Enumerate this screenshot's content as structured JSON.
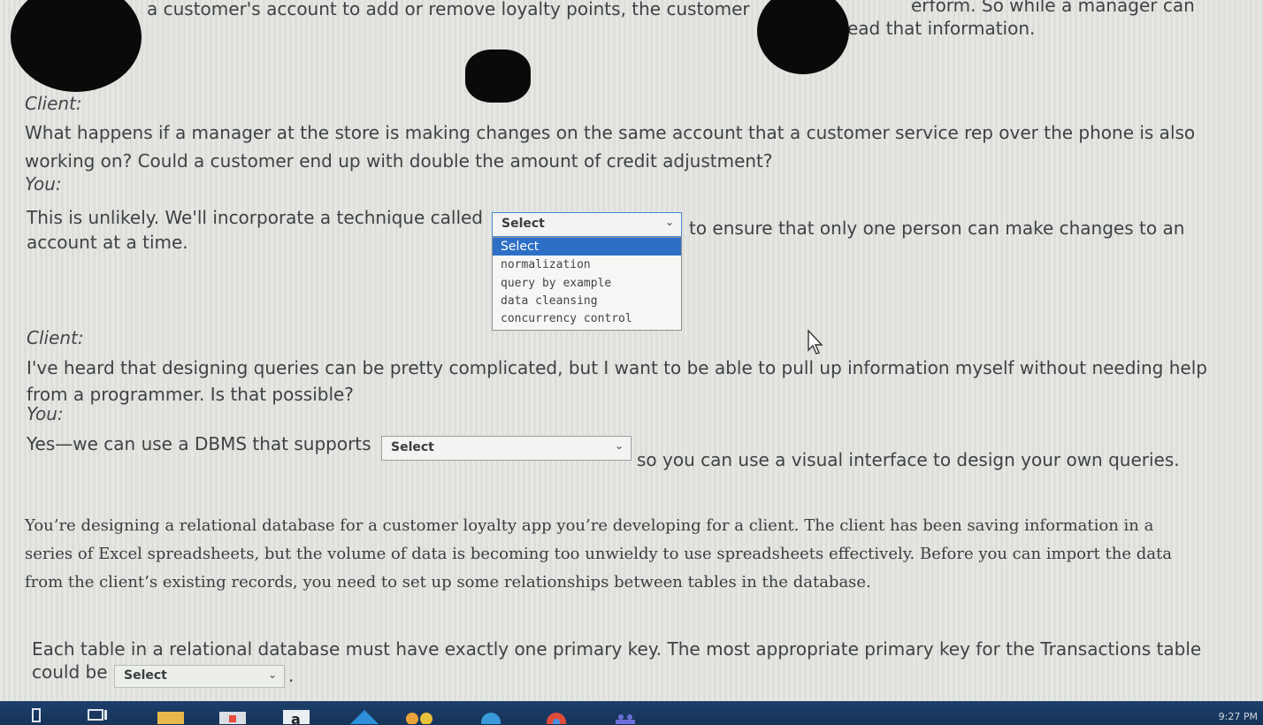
{
  "top": {
    "line1_left": "a customer's account to add or remove loyalty points, the customer",
    "line1_right": "erform. So while a manager can",
    "line2_right": "ead that information."
  },
  "dialog1": {
    "client_label": "Client:",
    "question_line1": "What happens if a manager at the store is making changes on the same account that a customer service rep over the phone is also",
    "question_line2": "working on? Could a customer end up with double the amount of credit adjustment?",
    "you_label": "You:",
    "answer_before": "This is unlikely. We'll incorporate a technique called",
    "answer_after": "to ensure that only one person can make changes to an",
    "answer_line2": "account at a time.",
    "select_value": "Select",
    "options": [
      "Select",
      "normalization",
      "query by example",
      "data cleansing",
      "concurrency control"
    ]
  },
  "dialog2": {
    "client_label": "Client:",
    "question_line1": "I've heard that designing queries can be pretty complicated, but I want to be able to pull up information myself without needing help",
    "question_line2": "from a programmer. Is that possible?",
    "you_label": "You:",
    "answer_before": "Yes—we can use a DBMS that supports",
    "answer_after": "so you can use a visual interface to design your own queries.",
    "select_value": "Select"
  },
  "scenario": {
    "line1": "You’re designing a relational database for a customer loyalty app you’re developing for a client. The client has been saving information in a",
    "line2": "series of Excel spreadsheets, but the volume of data is becoming too unwieldy to use spreadsheets effectively. Before you can import the data",
    "line3": "from the client’s existing records, you need to set up some relationships between tables in the database."
  },
  "question3": {
    "line1": "Each table in a relational database must have exactly one primary key. The most appropriate primary key for the Transactions table",
    "line2_before": "could be",
    "select_value": "Select",
    "line2_after": "."
  },
  "taskbar": {
    "clock": "9:27 PM",
    "icons": [
      "search-icon",
      "task-view-icon",
      "file-explorer-icon",
      "store-icon",
      "amazon-icon",
      "mail-icon",
      "people-icon",
      "edge-icon",
      "chrome-icon",
      "teams-icon"
    ]
  }
}
